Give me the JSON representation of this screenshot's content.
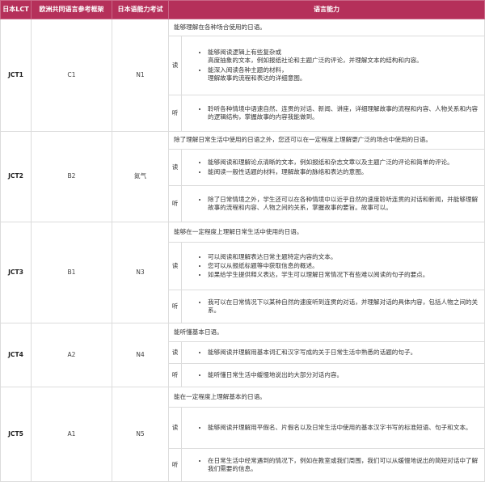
{
  "headers": {
    "lct": "日本LCT",
    "cefr": "欧洲共同语言参考框架",
    "jlpt": "日本语能力考试",
    "ability": "语言能力"
  },
  "rows": [
    {
      "level": "JCT1",
      "cefr": "C1",
      "jlpt": "N1",
      "summary": "能够理解在各种场合使用的日语。",
      "reading_label": "读",
      "reading": [
        "能够阅读逻辑上有些复杂或\n高度抽象的文本，例如报纸社论和主题广泛的评论，并理解文本的结构和内容。",
        "能深入阅读各种主题的材料，\n理解故事的流程和表达的详细意图。"
      ],
      "listening_label": "听",
      "listening": [
        "聆听各种情境中语速自然、连贯的对话、新闻、讲座，详细理解故事的流程和内容、人物关系和内容的逻辑结构，掌握故事的内容我能做到。"
      ]
    },
    {
      "level": "JCT2",
      "cefr": "B2",
      "jlpt": "氮气",
      "summary": "除了理解日常生活中使用的日语之外，您还可以在一定程度上理解更广泛的场合中使用的日语。",
      "reading_label": "读",
      "reading": [
        "能够阅读和理解论点清晰的文本，例如报纸和杂志文章以及主题广泛的评论和简单的评论。",
        "能阅读一般性话题的材料，理解故事的脉络和表达的意图。"
      ],
      "listening_label": "听",
      "listening": [
        "除了日常情境之外，学生还可以在各种情境中以近乎自然的速度聆听连贯的对话和新闻，并能够理解故事的流程和内容、人物之间的关系，掌握故事的要旨。故事可以。"
      ]
    },
    {
      "level": "JCT3",
      "cefr": "B1",
      "jlpt": "N3",
      "summary": "能够在一定程度上理解日常生活中使用的日语。",
      "reading_label": "读",
      "reading": [
        "可以阅读和理解表达日常主题特定内容的文本。",
        "您可以从报纸标题等中获取信息的概述。",
        "如果给学生提供释义表达，学生可以理解日常情况下有些难以阅读的句子的要点。"
      ],
      "listening_label": "听",
      "listening": [
        "我可以在日常情况下以某种自然的速度听到连贯的对话，并理解对话的具体内容，包括人物之间的关系。"
      ]
    },
    {
      "level": "JCT4",
      "cefr": "A2",
      "jlpt": "N4",
      "summary": "能听懂基本日语。",
      "reading_label": "读",
      "reading": [
        "能够阅读并理解用基本词汇和汉字写成的关于日常生活中熟悉的话题的句子。"
      ],
      "listening_label": "听",
      "listening": [
        "能听懂日常生活中缓慢地说出的大部分对话内容。"
      ]
    },
    {
      "level": "JCT5",
      "cefr": "A1",
      "jlpt": "N5",
      "summary": "能在一定程度上理解基本的日语。",
      "reading_label": "读",
      "reading": [
        "能够阅读并理解用平假名、片假名以及日常生活中使用的基本汉字书写的标准短语、句子和文本。"
      ],
      "listening_label": "听",
      "listening": [
        "在日常生活中经常遇到的情况下，例如在教室或我们周围，我们可以从缓慢地说出的简短对话中了解我们需要的信息。"
      ]
    }
  ]
}
